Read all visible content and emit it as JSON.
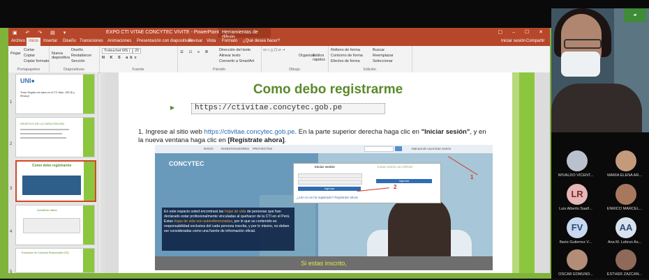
{
  "window": {
    "title": "EXPO CTI VITAE CONCYTEC VIVITE - PowerPoint",
    "context_tab": "Herramientas de dibujo",
    "search": "¿Qué desea hacer?",
    "signin": "Iniciar sesión",
    "share": "Compartir"
  },
  "ribbon": {
    "tabs": [
      "Archivo",
      "Inicio",
      "Insertar",
      "Diseño",
      "Transiciones",
      "Animaciones",
      "Presentación con diapositivas",
      "Revisar",
      "Vista",
      "Formato"
    ],
    "active_tab": "Inicio",
    "groups": [
      {
        "label": "Portapapeles",
        "items": [
          "Pegar",
          "Cortar",
          "Copiar",
          "Copiar formato"
        ]
      },
      {
        "label": "Diapositivas",
        "items": [
          "Nueva diapositiva",
          "Diseño",
          "Restablecer",
          "Sección"
        ]
      },
      {
        "label": "Fuente",
        "items": [
          "Trebuchet MS (",
          "20"
        ]
      },
      {
        "label": "Párrafo",
        "items": [
          "Dirección del texto",
          "Alinear texto",
          "Convertir a SmartArt"
        ]
      },
      {
        "label": "Dibujo",
        "items": [
          "Organizar",
          "Estilos rápidos"
        ]
      },
      {
        "label": "Edición",
        "items": [
          "Relleno de forma",
          "Contorno de forma",
          "Efectos de forma",
          "Buscar",
          "Reemplazar",
          "Seleccionar"
        ]
      }
    ]
  },
  "thumbnails": [
    {
      "num": "1",
      "title": "Tema: Registro de datos en el CTI Vitae, ORCID y Renacyt"
    },
    {
      "num": "2",
      "title": "OBJETIVO DE LA CAPACITACIÓN"
    },
    {
      "num": "3",
      "title": "Como debo registrarme"
    },
    {
      "num": "4",
      "title": "Actualizar datos"
    },
    {
      "num": "5",
      "title": "Evaluación de Conducta Responsable (CR)"
    }
  ],
  "slide": {
    "title": "Como debo registrarme",
    "url": "https://ctivitae.concytec.gob.pe",
    "step_number": "1.",
    "step_text_1": "Ingrese al sitio web",
    "step_link": "https://ctivitae.concytec.gob.pe",
    "step_text_2": ". En la parte superior derecha haga clic en",
    "step_bold_1": "\"Iniciar sesión\"",
    "step_text_3": ", y en la nueva ventana haga clic en",
    "step_bold_2": "[Regístrate ahora]",
    "step_text_4": ".",
    "caption": "Si estas inscrito,",
    "screenshot": {
      "logo": "CONCYTEC",
      "nav": [
        "INICIO",
        "INVESTIGADORES",
        "PROYECTOS"
      ],
      "login_title": "Iniciar sesión",
      "login_orcid": "Iniciar sesión con ORCID",
      "login_button": "Ingresar",
      "register_link": "¿Aún no se ha registrado? Regístrate ahora",
      "manual": "Manual de uso",
      "session": "Iniciar sesión",
      "callout_1": "1",
      "callout_2": "2",
      "info_text_1": "En este espacio usted encontrará las",
      "info_hl_1": "hojas de vida",
      "info_text_2": "de personas que han declarado estar profesionalmente vinculadas al quehacer de la CTI en el Perú.",
      "info_text_3": "Estas",
      "info_hl_2": "hojas de vida son autoreferenciadas",
      "info_text_4": ", por lo que su contenido es responsabilidad exclusiva del cada persona inscrita, y por lo mismo, no deben ser consideradas como una fuente de información oficial."
    }
  },
  "participants": [
    {
      "name": "WIVALDO VICENT...",
      "initials": "",
      "photo": true
    },
    {
      "name": "MARIA ELENA AR...",
      "initials": "",
      "photo": true
    },
    {
      "name": "Luis Alberto Saañ...",
      "initials": "LR",
      "color": "#e7b6b6",
      "photo": false
    },
    {
      "name": "ENRICO MARCEL...",
      "initials": "",
      "photo": true
    },
    {
      "name": "flavio Gutierrez V...",
      "initials": "FV",
      "color": "#c8d8f0",
      "photo": false
    },
    {
      "name": "Ana M. Lebrun As...",
      "initials": "AA",
      "color": "#d8e2ec",
      "photo": false
    },
    {
      "name": "OSCAR EDMUND...",
      "initials": "",
      "photo": true
    },
    {
      "name": "ESTHER ZAZCAN...",
      "initials": "",
      "photo": true
    }
  ],
  "colors": {
    "accent": "#b7472a",
    "slide_green": "#8cc63f",
    "title_green": "#5a8a2a",
    "callout_red": "#d9301c"
  }
}
